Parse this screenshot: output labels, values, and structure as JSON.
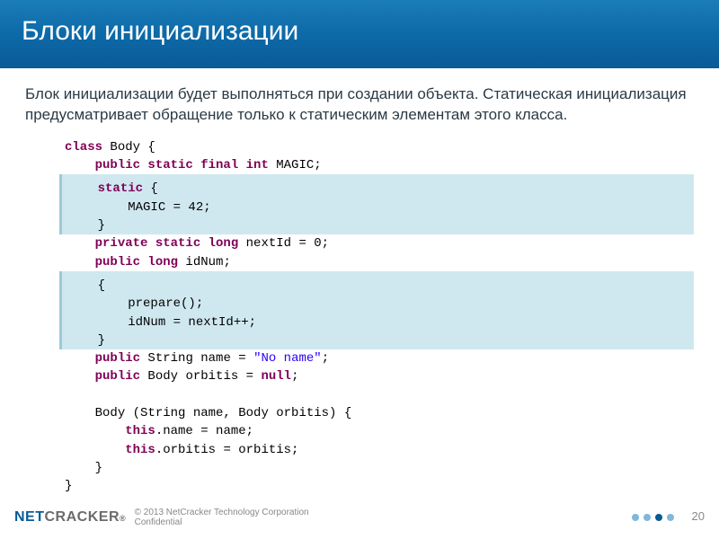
{
  "title": "Блоки инициализации",
  "intro": "Блок инициализации будет выполняться при создании объекта. Статическая инициализация предусматривает обращение только к статическим элементам этого класса.",
  "code": {
    "l1": {
      "kw1": "class",
      "id": " Body {"
    },
    "l2": {
      "kw": "public static final int",
      "id": " MAGIC;"
    },
    "l3": {
      "kw": "static",
      "br": " {"
    },
    "l4": "MAGIC = 42;",
    "l5": "}",
    "l6": {
      "kw": "private static long",
      "rest": " nextId = 0;"
    },
    "l7": {
      "kw": "public long",
      "rest": " idNum;"
    },
    "l8": "{",
    "l9": "prepare();",
    "l10": "idNum = nextId++;",
    "l11": "}",
    "l12": {
      "kw": "public",
      "rest1": " String name = ",
      "str": "\"No name\"",
      "rest2": ";"
    },
    "l13": {
      "kw": "public",
      "rest": " Body orbitis = ",
      "kw2": "null",
      "rest2": ";"
    },
    "l14": "Body (String name, Body orbitis) {",
    "l15": {
      "kw": "this",
      "rest": ".name = name;"
    },
    "l16": {
      "kw": "this",
      "rest": ".orbitis = orbitis;"
    },
    "l17": "}",
    "l18": "}"
  },
  "footer": {
    "logo_net": "NET",
    "logo_cracker": "CRACKER",
    "reg": "®",
    "copyright_line1": "© 2013 NetCracker Technology Corporation",
    "copyright_line2": "Confidential",
    "page_number": "20"
  }
}
